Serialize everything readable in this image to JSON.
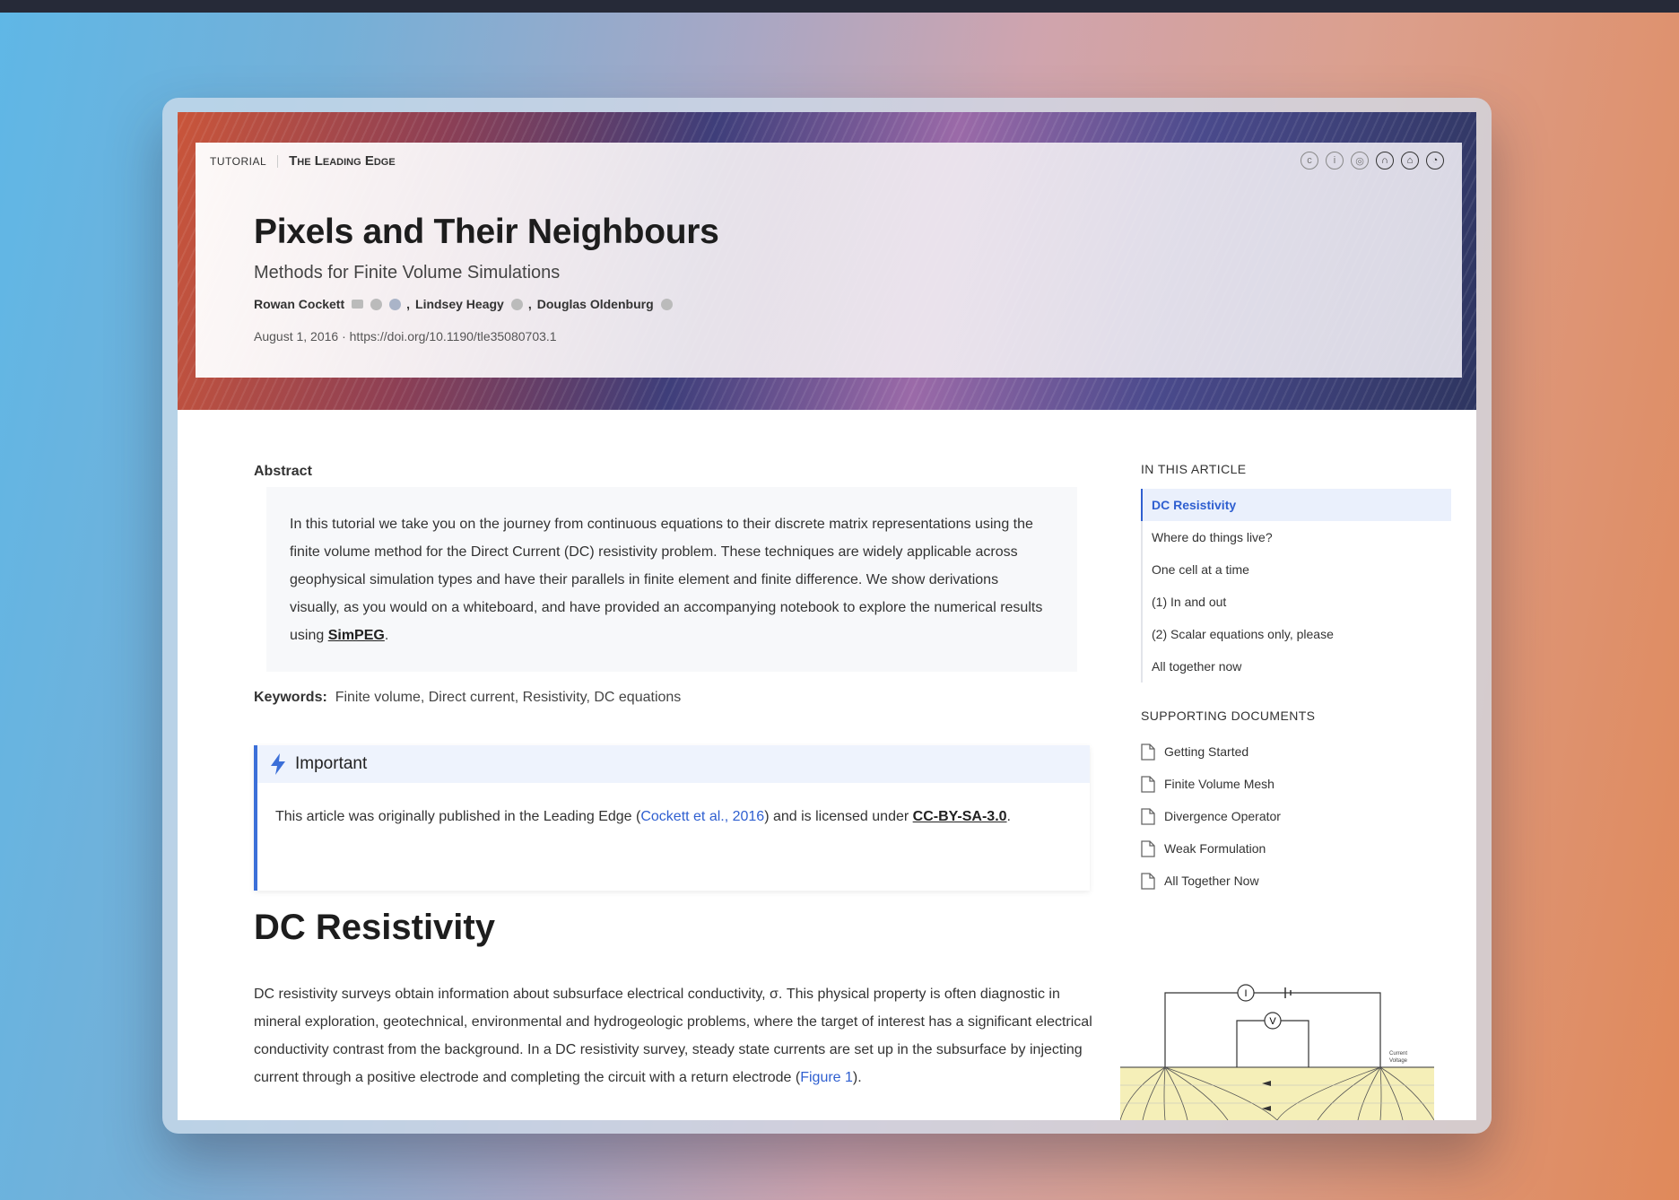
{
  "hero": {
    "kind": "TUTORIAL",
    "venue": "The Leading Edge",
    "title": "Pixels and Their Neighbours",
    "subtitle": "Methods for Finite Volume Simulations",
    "authors": [
      {
        "name": "Rowan Cockett"
      },
      {
        "name": "Lindsey Heagy"
      },
      {
        "name": "Douglas Oldenburg"
      }
    ],
    "separator": ",",
    "date": "August 1, 2016",
    "dot": "·",
    "doi": "https://doi.org/10.1190/tle35080703.1"
  },
  "abstract": {
    "label": "Abstract",
    "text": "In this tutorial we take you on the journey from continuous equations to their discrete matrix representations using the finite volume method for the Direct Current (DC) resistivity problem. These techniques are widely applicable across geophysical simulation types and have their parallels in finite element and finite difference. We show derivations visually, as you would on a whiteboard, and have provided an accompanying notebook to explore the numerical results using ",
    "link": "SimPEG",
    "end": "."
  },
  "keywords": {
    "label": "Keywords:",
    "text": "Finite volume, Direct current, Resistivity, DC equations"
  },
  "callout": {
    "title": "Important",
    "text_before": "This article was originally published in the Leading Edge (",
    "cite": "Cockett et al., 2016",
    "text_mid": ") and is licensed under ",
    "license": "CC-BY-SA-3.0",
    "text_after": "."
  },
  "section": {
    "heading": "DC Resistivity",
    "text_before": "DC resistivity surveys obtain information about subsurface electrical conductivity, σ. This physical property is often diagnostic in mineral exploration, geotechnical, environmental and hydrogeologic problems, where the target of interest has a significant electrical conductivity contrast from the background. In a DC resistivity survey, steady state currents are set up in the subsurface by injecting current through a positive electrode and completing the circuit with a return electrode (",
    "cite": "Figure 1",
    "text_after": ")."
  },
  "sidebar": {
    "toc_heading": "IN THIS ARTICLE",
    "toc": [
      "DC Resistivity",
      "Where do things live?",
      "One cell at a time",
      "(1) In and out",
      "(2) Scalar equations only, please",
      "All together now"
    ],
    "docs_heading": "SUPPORTING DOCUMENTS",
    "docs": [
      "Getting Started",
      "Finite Volume Mesh",
      "Divergence Operator",
      "Weak Formulation",
      "All Together Now"
    ]
  },
  "figure": {
    "current_label": "I",
    "voltage_label": "V",
    "legend_current": "Current",
    "legend_voltage": "Voltage"
  },
  "colors": {
    "accent": "#2f5fd0",
    "callout_border": "#3b6fd8",
    "callout_bg": "#eef3fd"
  }
}
